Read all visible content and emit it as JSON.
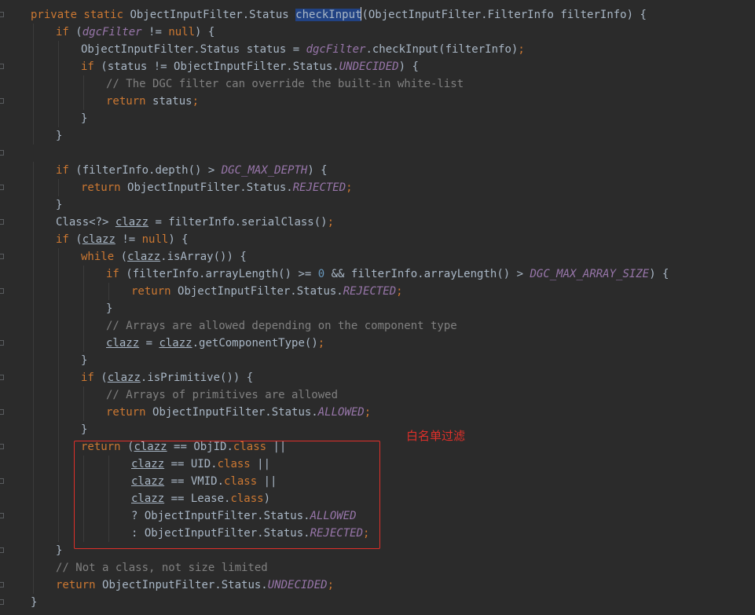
{
  "annotation": {
    "label": "白名单过滤",
    "color": "#e0302a"
  },
  "code_lines": [
    {
      "indent": 0,
      "tokens": [
        {
          "t": "private static ",
          "c": "kw"
        },
        {
          "t": "ObjectInputFilter.Status "
        },
        {
          "t": "checkInput",
          "c": "sel"
        },
        {
          "t": "(ObjectInputFilter.FilterInfo filterInfo) {"
        }
      ]
    },
    {
      "indent": 1,
      "tokens": [
        {
          "t": "if ",
          "c": "kw"
        },
        {
          "t": "("
        },
        {
          "t": "dgcFilter",
          "c": "fld"
        },
        {
          "t": " != "
        },
        {
          "t": "null",
          "c": "kw"
        },
        {
          "t": ") {"
        }
      ]
    },
    {
      "indent": 2,
      "tokens": [
        {
          "t": "ObjectInputFilter.Status status = "
        },
        {
          "t": "dgcFilter",
          "c": "fld"
        },
        {
          "t": ".checkInput(filterInfo)"
        },
        {
          "t": ";",
          "c": "kw"
        }
      ]
    },
    {
      "indent": 2,
      "tokens": [
        {
          "t": "if ",
          "c": "kw"
        },
        {
          "t": "(status != ObjectInputFilter.Status."
        },
        {
          "t": "UNDECIDED",
          "c": "fld"
        },
        {
          "t": ") {"
        }
      ]
    },
    {
      "indent": 3,
      "tokens": [
        {
          "t": "// The DGC filter can override the built-in white-list",
          "c": "cmt"
        }
      ]
    },
    {
      "indent": 3,
      "tokens": [
        {
          "t": "return ",
          "c": "kw"
        },
        {
          "t": "status"
        },
        {
          "t": ";",
          "c": "kw"
        }
      ]
    },
    {
      "indent": 2,
      "tokens": [
        {
          "t": "}"
        }
      ]
    },
    {
      "indent": 1,
      "tokens": [
        {
          "t": "}"
        }
      ]
    },
    {
      "indent": 0,
      "tokens": []
    },
    {
      "indent": 1,
      "tokens": [
        {
          "t": "if ",
          "c": "kw"
        },
        {
          "t": "(filterInfo.depth() > "
        },
        {
          "t": "DGC_MAX_DEPTH",
          "c": "fld"
        },
        {
          "t": ") {"
        }
      ]
    },
    {
      "indent": 2,
      "tokens": [
        {
          "t": "return ",
          "c": "kw"
        },
        {
          "t": "ObjectInputFilter.Status."
        },
        {
          "t": "REJECTED",
          "c": "fld"
        },
        {
          "t": ";",
          "c": "kw"
        }
      ]
    },
    {
      "indent": 1,
      "tokens": [
        {
          "t": "}"
        }
      ]
    },
    {
      "indent": 1,
      "tokens": [
        {
          "t": "Class<?> "
        },
        {
          "t": "clazz",
          "c": "ul"
        },
        {
          "t": " = filterInfo.serialClass()"
        },
        {
          "t": ";",
          "c": "kw"
        }
      ]
    },
    {
      "indent": 1,
      "tokens": [
        {
          "t": "if ",
          "c": "kw"
        },
        {
          "t": "("
        },
        {
          "t": "clazz",
          "c": "ul"
        },
        {
          "t": " != "
        },
        {
          "t": "null",
          "c": "kw"
        },
        {
          "t": ") {"
        }
      ]
    },
    {
      "indent": 2,
      "tokens": [
        {
          "t": "while ",
          "c": "kw"
        },
        {
          "t": "("
        },
        {
          "t": "clazz",
          "c": "ul"
        },
        {
          "t": ".isArray()) {"
        }
      ]
    },
    {
      "indent": 3,
      "tokens": [
        {
          "t": "if ",
          "c": "kw"
        },
        {
          "t": "(filterInfo.arrayLength() >= "
        },
        {
          "t": "0",
          "c": "num"
        },
        {
          "t": " && filterInfo.arrayLength() > "
        },
        {
          "t": "DGC_MAX_ARRAY_SIZE",
          "c": "fld"
        },
        {
          "t": ") {"
        }
      ]
    },
    {
      "indent": 4,
      "tokens": [
        {
          "t": "return ",
          "c": "kw"
        },
        {
          "t": "ObjectInputFilter.Status."
        },
        {
          "t": "REJECTED",
          "c": "fld"
        },
        {
          "t": ";",
          "c": "kw"
        }
      ]
    },
    {
      "indent": 3,
      "tokens": [
        {
          "t": "}"
        }
      ]
    },
    {
      "indent": 3,
      "tokens": [
        {
          "t": "// Arrays are allowed depending on the component type",
          "c": "cmt"
        }
      ]
    },
    {
      "indent": 3,
      "tokens": [
        {
          "t": "clazz",
          "c": "ul"
        },
        {
          "t": " = "
        },
        {
          "t": "clazz",
          "c": "ul"
        },
        {
          "t": ".getComponentType()"
        },
        {
          "t": ";",
          "c": "kw"
        }
      ]
    },
    {
      "indent": 2,
      "tokens": [
        {
          "t": "}"
        }
      ]
    },
    {
      "indent": 2,
      "tokens": [
        {
          "t": "if ",
          "c": "kw"
        },
        {
          "t": "("
        },
        {
          "t": "clazz",
          "c": "ul"
        },
        {
          "t": ".isPrimitive()) {"
        }
      ]
    },
    {
      "indent": 3,
      "tokens": [
        {
          "t": "// Arrays of primitives are allowed",
          "c": "cmt"
        }
      ]
    },
    {
      "indent": 3,
      "tokens": [
        {
          "t": "return ",
          "c": "kw"
        },
        {
          "t": "ObjectInputFilter.Status."
        },
        {
          "t": "ALLOWED",
          "c": "fld"
        },
        {
          "t": ";",
          "c": "kw"
        }
      ]
    },
    {
      "indent": 2,
      "tokens": [
        {
          "t": "}"
        }
      ]
    },
    {
      "indent": 2,
      "tokens": [
        {
          "t": "return ",
          "c": "kw"
        },
        {
          "t": "("
        },
        {
          "t": "clazz",
          "c": "ul"
        },
        {
          "t": " == ObjID."
        },
        {
          "t": "class",
          "c": "kw"
        },
        {
          "t": " ||"
        }
      ]
    },
    {
      "indent": 4,
      "tokens": [
        {
          "t": "clazz",
          "c": "ul"
        },
        {
          "t": " == UID."
        },
        {
          "t": "class",
          "c": "kw"
        },
        {
          "t": " ||"
        }
      ]
    },
    {
      "indent": 4,
      "tokens": [
        {
          "t": "clazz",
          "c": "ul"
        },
        {
          "t": " == VMID."
        },
        {
          "t": "class",
          "c": "kw"
        },
        {
          "t": " ||"
        }
      ]
    },
    {
      "indent": 4,
      "tokens": [
        {
          "t": "clazz",
          "c": "ul"
        },
        {
          "t": " == Lease."
        },
        {
          "t": "class",
          "c": "kw"
        },
        {
          "t": ")"
        }
      ]
    },
    {
      "indent": 4,
      "tokens": [
        {
          "t": "? ObjectInputFilter.Status."
        },
        {
          "t": "ALLOWED",
          "c": "fld"
        }
      ]
    },
    {
      "indent": 4,
      "tokens": [
        {
          "t": ": ObjectInputFilter.Status."
        },
        {
          "t": "REJECTED",
          "c": "fld"
        },
        {
          "t": ";",
          "c": "kw"
        }
      ]
    },
    {
      "indent": 1,
      "tokens": [
        {
          "t": "}"
        }
      ]
    },
    {
      "indent": 1,
      "tokens": [
        {
          "t": "// Not a class, not size limited",
          "c": "cmt"
        }
      ]
    },
    {
      "indent": 1,
      "tokens": [
        {
          "t": "return ",
          "c": "kw"
        },
        {
          "t": "ObjectInputFilter.Status."
        },
        {
          "t": "UNDECIDED",
          "c": "fld"
        },
        {
          "t": ";",
          "c": "kw"
        }
      ]
    },
    {
      "indent": 0,
      "tokens": [
        {
          "t": "}"
        }
      ]
    }
  ]
}
